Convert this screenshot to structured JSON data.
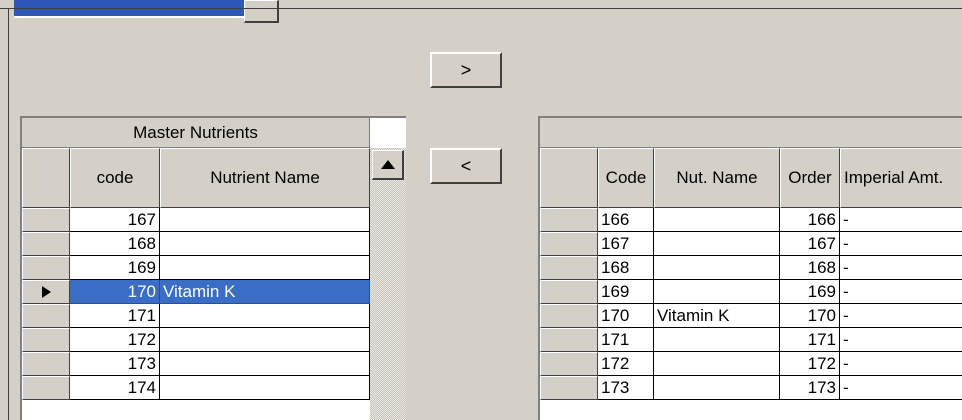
{
  "window": {
    "top_combo_icon": "dropdown-arrow-icon"
  },
  "buttons": {
    "add_label": ">",
    "remove_label": "<"
  },
  "master_grid": {
    "caption": "Master Nutrients",
    "columns": [
      "code",
      "Nutrient Name"
    ],
    "rows": [
      {
        "code": "167",
        "name": ""
      },
      {
        "code": "168",
        "name": ""
      },
      {
        "code": "169",
        "name": ""
      },
      {
        "code": "170",
        "name": "Vitamin K",
        "selected": true
      },
      {
        "code": "171",
        "name": ""
      },
      {
        "code": "172",
        "name": ""
      },
      {
        "code": "173",
        "name": ""
      },
      {
        "code": "174",
        "name": ""
      }
    ],
    "current_row_icon": "row-pointer-triangle-icon",
    "scroll_up_icon": "scroll-up-arrow-icon",
    "selection_color": "#3a6ec6"
  },
  "selected_grid": {
    "caption": "",
    "columns": [
      "Code",
      "Nut. Name",
      "Order",
      "Imperial Amt."
    ],
    "rows": [
      {
        "code": "166",
        "name": "",
        "order": "166",
        "imperial": "-"
      },
      {
        "code": "167",
        "name": "",
        "order": "167",
        "imperial": "-"
      },
      {
        "code": "168",
        "name": "",
        "order": "168",
        "imperial": "-"
      },
      {
        "code": "169",
        "name": "",
        "order": "169",
        "imperial": "-"
      },
      {
        "code": "170",
        "name": "Vitamin K",
        "order": "170",
        "imperial": "-"
      },
      {
        "code": "171",
        "name": "",
        "order": "171",
        "imperial": "-"
      },
      {
        "code": "172",
        "name": "",
        "order": "172",
        "imperial": "-"
      },
      {
        "code": "173",
        "name": "",
        "order": "173",
        "imperial": "-"
      }
    ]
  }
}
